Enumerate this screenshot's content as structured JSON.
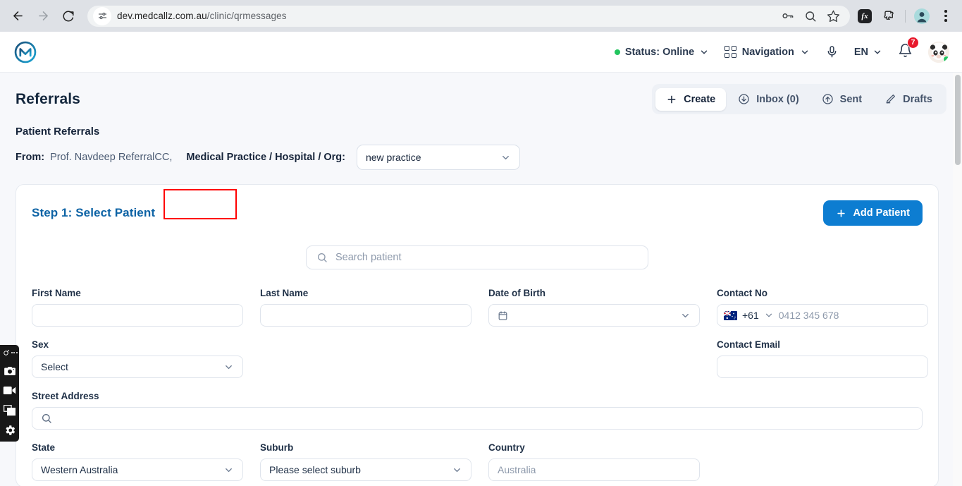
{
  "browser": {
    "back_icon": "back-arrow-icon",
    "forward_icon": "forward-arrow-icon",
    "reload_icon": "reload-icon",
    "site_info_icon": "site-settings-icon",
    "url_host": "dev.medcallz.com.au",
    "url_path": "/clinic/qrmessages",
    "password_icon": "key-icon",
    "search_icon": "zoom-search-icon",
    "bookmark_icon": "star-icon",
    "extension_fx_label": "fx",
    "extensions_icon": "puzzle-piece-icon",
    "profile_icon": "profile-avatar-icon",
    "menu_icon": "three-dot-menu-icon"
  },
  "app_header": {
    "logo_name": "medcallz-logo",
    "status_label": "Status: Online",
    "status_color": "#22c55e",
    "navigation_label": "Navigation",
    "mic_icon": "microphone-icon",
    "language_label": "EN",
    "bell_icon": "notification-bell-icon",
    "notification_count": "7",
    "avatar_name": "user-avatar"
  },
  "page": {
    "title": "Referrals",
    "tabs": [
      {
        "label": "Create",
        "icon": "plus-icon",
        "active": true
      },
      {
        "label": "Inbox (0)",
        "icon": "inbox-download-icon",
        "active": false
      },
      {
        "label": "Sent",
        "icon": "sent-upload-icon",
        "active": false
      },
      {
        "label": "Drafts",
        "icon": "pencil-icon",
        "active": false
      }
    ],
    "section_title": "Patient Referrals",
    "from_label": "From:",
    "from_value": "Prof. Navdeep ReferralCC,",
    "org_label": "Medical Practice / Hospital / Org:",
    "org_value": "new practice"
  },
  "card": {
    "step_title": "Step 1: Select Patient",
    "add_patient_label": "Add Patient",
    "accent_color": "#0d7dd1",
    "annotation_color": "#ff0000",
    "search_placeholder": "Search patient",
    "fields": {
      "first_name": {
        "label": "First Name",
        "value": ""
      },
      "last_name": {
        "label": "Last Name",
        "value": ""
      },
      "dob": {
        "label": "Date of Birth",
        "value": "",
        "icon": "calendar-icon"
      },
      "contact_no": {
        "label": "Contact No",
        "country_code": "+61",
        "placeholder": "0412 345 678",
        "flag": "australia-flag-icon"
      },
      "sex": {
        "label": "Sex",
        "value": "Select"
      },
      "contact_email": {
        "label": "Contact Email",
        "value": ""
      },
      "street_address": {
        "label": "Street Address",
        "value": "",
        "icon": "search-icon"
      },
      "state": {
        "label": "State",
        "value": "Western Australia"
      },
      "suburb": {
        "label": "Suburb",
        "value": "Please select suburb"
      },
      "country": {
        "label": "Country",
        "value": "Australia"
      }
    }
  },
  "recorder_toolbar": {
    "items": [
      {
        "name": "recorder-logo-handle"
      },
      {
        "name": "camera-screenshot-icon"
      },
      {
        "name": "video-record-icon"
      },
      {
        "name": "screen-window-icon"
      },
      {
        "name": "settings-gear-icon"
      }
    ]
  }
}
